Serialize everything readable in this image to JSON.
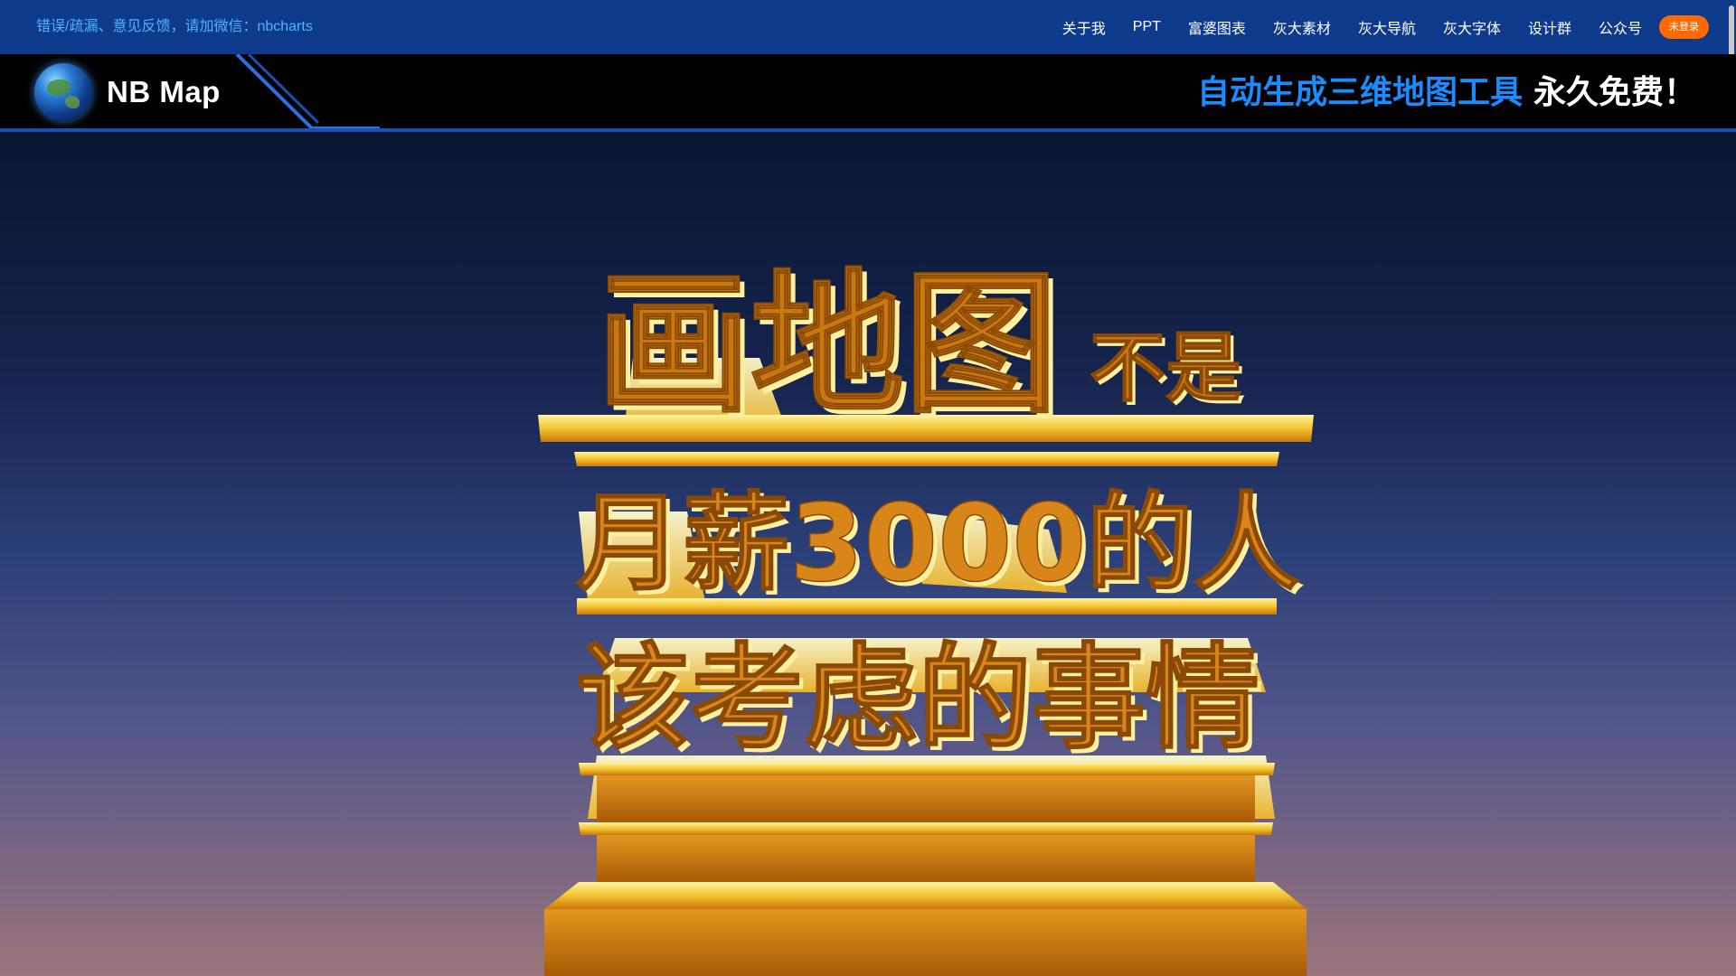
{
  "topbar": {
    "feedback": "错误/疏漏、意见反馈，请加微信：nbcharts",
    "nav": [
      "关于我",
      "PPT",
      "富婆图表",
      "灰大素材",
      "灰大导航",
      "灰大字体",
      "设计群",
      "公众号"
    ],
    "login_label": "未登录"
  },
  "header": {
    "app_title": "NB Map",
    "slogan_highlight": "自动生成三维地图工具",
    "slogan_tail": "永久免费！"
  },
  "hero": {
    "line1_big": "画地图",
    "line1_small": "不是",
    "line2": "月薪3000的人",
    "line3": "该考虑的事情"
  },
  "colors": {
    "topbar_bg": "#0d3a8a",
    "accent_blue": "#1a8cff",
    "login_orange": "#ff6a00",
    "text_gold": "#d98a1e",
    "bar_gold": "#f7c43a"
  },
  "icons": {
    "logo": "globe-icon"
  }
}
